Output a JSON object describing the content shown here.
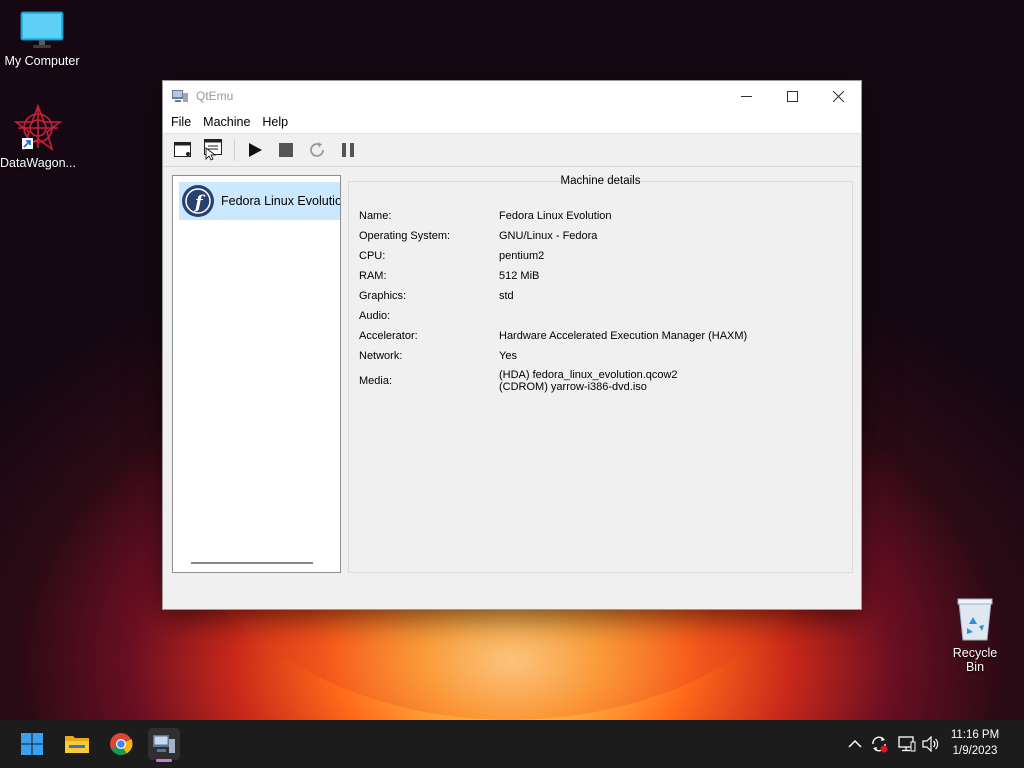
{
  "desktop": {
    "icons": [
      {
        "label": "My Computer",
        "icon": "monitor-icon"
      },
      {
        "label": "DataWagon...",
        "icon": "datawagon-icon"
      }
    ],
    "recycle_bin": {
      "label": "Recycle Bin",
      "icon": "recycle-bin-icon"
    }
  },
  "window": {
    "title": "QtEmu",
    "controls": {
      "minimize": "—",
      "maximize": "☐",
      "close": "✕"
    },
    "menu": [
      "File",
      "Machine",
      "Help"
    ],
    "toolbar": [
      {
        "name": "new-machine",
        "icon": "new-window-icon"
      },
      {
        "name": "settings",
        "icon": "settings-window-icon"
      },
      {
        "name": "start",
        "icon": "play-icon"
      },
      {
        "name": "stop",
        "icon": "stop-icon"
      },
      {
        "name": "reset",
        "icon": "reset-icon"
      },
      {
        "name": "pause",
        "icon": "pause-icon"
      }
    ],
    "machines": [
      {
        "label": "Fedora Linux Evolution",
        "icon": "fedora-logo-icon",
        "selected": true
      }
    ],
    "details": {
      "header": "Machine details",
      "rows": [
        {
          "key": "Name:",
          "value": "Fedora Linux Evolution"
        },
        {
          "key": "Operating System:",
          "value": "GNU/Linux - Fedora"
        },
        {
          "key": "CPU:",
          "value": "pentium2"
        },
        {
          "key": "RAM:",
          "value": "512 MiB"
        },
        {
          "key": "Graphics:",
          "value": "std"
        },
        {
          "key": "Audio:",
          "value": ""
        },
        {
          "key": "Accelerator:",
          "value": "Hardware Accelerated Execution Manager (HAXM)"
        },
        {
          "key": "Network:",
          "value": "Yes"
        },
        {
          "key": "Media:",
          "value": "(HDA) fedora_linux_evolution.qcow2",
          "value2": "(CDROM) yarrow-i386-dvd.iso"
        }
      ]
    }
  },
  "taskbar": {
    "apps": [
      {
        "name": "start",
        "icon": "windows-start-icon"
      },
      {
        "name": "file-explorer",
        "icon": "folder-icon"
      },
      {
        "name": "chrome",
        "icon": "chrome-icon"
      },
      {
        "name": "qtemu",
        "icon": "qtemu-icon",
        "active": true
      }
    ],
    "tray": [
      "chevron-up-icon",
      "sync-icon",
      "network-icon",
      "volume-icon"
    ],
    "clock": {
      "time": "11:16 PM",
      "date": "1/9/2023"
    }
  },
  "colors": {
    "selection": "#cce8ff",
    "taskbar": "#1c1c1c",
    "fedora_blue": "#294172"
  }
}
